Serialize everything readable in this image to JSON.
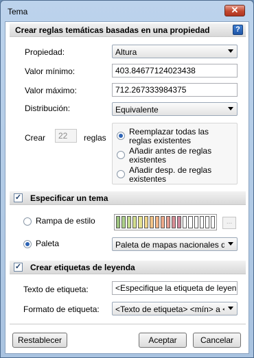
{
  "window": {
    "title": "Tema",
    "close_glyph": "✕"
  },
  "section1": {
    "title": "Crear reglas temáticas basadas en una propiedad",
    "help_glyph": "?"
  },
  "form": {
    "property_label": "Propiedad:",
    "property_value": "Altura",
    "min_label": "Valor mínimo:",
    "min_value": "403.84677124023438",
    "max_label": "Valor máximo:",
    "max_value": "712.267333984375",
    "distribution_label": "Distribución:",
    "distribution_value": "Equivalente",
    "create_label": "Crear",
    "rules_count": "22",
    "rules_label": "reglas"
  },
  "rule_options": [
    {
      "label": "Reemplazar todas las reglas existentes",
      "checked": true
    },
    {
      "label": "Añadir antes de reglas existentes",
      "checked": false
    },
    {
      "label": "Añadir desp. de reglas existentes",
      "checked": false
    }
  ],
  "section2": {
    "title": "Especificar un tema",
    "checked": true
  },
  "theme": {
    "ramp_label": "Rampa de estilo",
    "palette_label": "Paleta",
    "palette_value": "Paleta de mapas nacionales de U",
    "ellipsis": "...",
    "ramp_colors": [
      "#9ec47f",
      "#aed28a",
      "#c2d98d",
      "#d4df8f",
      "#e6e28f",
      "#f0d58a",
      "#f3c487",
      "#f2b586",
      "#eda989",
      "#e39b8f",
      "#d88f96",
      "#cc889c",
      "#ffffff",
      "#ffffff",
      "#ffffff",
      "#ffffff",
      "#ffffff",
      "#ffffff"
    ]
  },
  "section3": {
    "title": "Crear etiquetas de leyenda",
    "checked": true
  },
  "legend": {
    "text_label": "Texto de etiqueta:",
    "text_value": "<Especifique la etiqueta de leyenda>",
    "format_label": "Formato de etiqueta:",
    "format_value": "<Texto de etiqueta> <mín> a <má"
  },
  "buttons": {
    "reset": "Restablecer",
    "accept": "Aceptar",
    "cancel": "Cancelar"
  }
}
